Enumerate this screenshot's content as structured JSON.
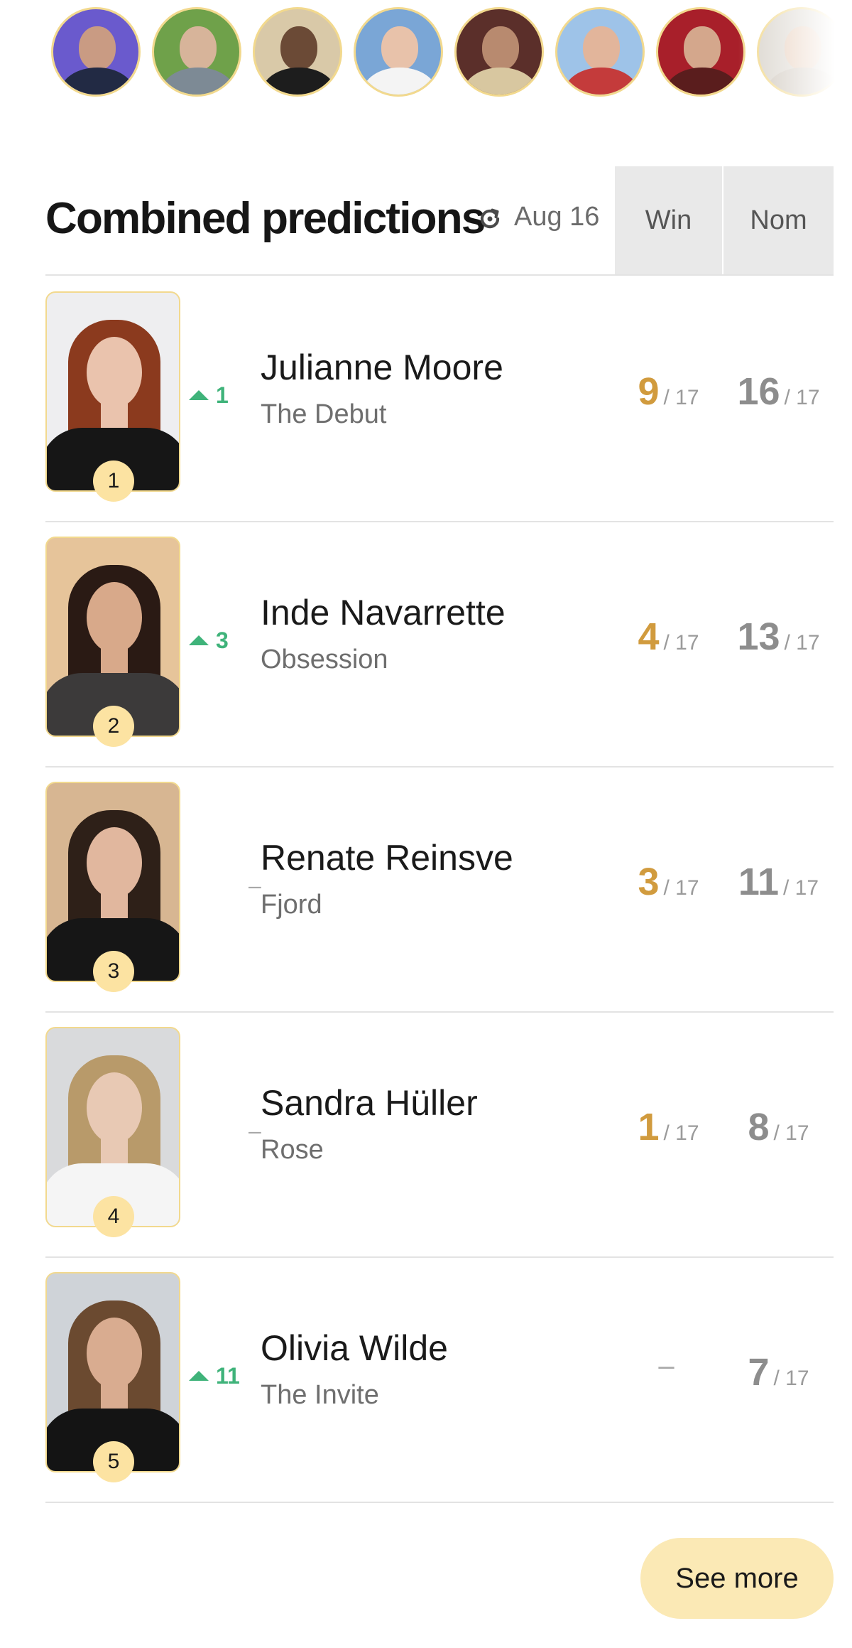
{
  "predictors": [
    {
      "name": "predictor-1",
      "bg": "#6a5acd",
      "skin": "#c99b83",
      "shirt": "#222a44"
    },
    {
      "name": "predictor-2",
      "bg": "#6fa14a",
      "skin": "#d7b49a",
      "shirt": "#7d8a95"
    },
    {
      "name": "predictor-3",
      "bg": "#d9c9a8",
      "skin": "#6b4a36",
      "shirt": "#1d1d1d"
    },
    {
      "name": "predictor-4",
      "bg": "#7aa6d6",
      "skin": "#e8c2aa",
      "shirt": "#f4f4f4"
    },
    {
      "name": "predictor-5",
      "bg": "#5b2f2a",
      "skin": "#b88a6f",
      "shirt": "#d8c7a0"
    },
    {
      "name": "predictor-6",
      "bg": "#9ec3e8",
      "skin": "#e2b59b",
      "shirt": "#c43b3b"
    },
    {
      "name": "predictor-7",
      "bg": "#a81f2a",
      "skin": "#d4a78c",
      "shirt": "#5a1d1d"
    },
    {
      "name": "predictor-8",
      "bg": "#d9d4cc",
      "skin": "#e6cbb7",
      "shirt": "#cfc7bd"
    }
  ],
  "header": {
    "title": "Combined predictions",
    "refresh_icon": "refresh-icon",
    "updated": "Aug 16",
    "col_win": "Win",
    "col_nom": "Nom"
  },
  "rows": [
    {
      "rank": "1",
      "name": "Julianne Moore",
      "film": "The Debut",
      "trend": "up",
      "trend_value": "1",
      "win": "9",
      "win_total": "/ 17",
      "nom": "16",
      "nom_total": "/ 17",
      "photo": {
        "bg": "#eeeef0",
        "hair": "#8b3a1e",
        "skin": "#eac3ad",
        "top": "#161616"
      }
    },
    {
      "rank": "2",
      "name": "Inde Navarrette",
      "film": "Obsession",
      "trend": "up",
      "trend_value": "3",
      "win": "4",
      "win_total": "/ 17",
      "nom": "13",
      "nom_total": "/ 17",
      "photo": {
        "bg": "#e6c49a",
        "hair": "#2a1a14",
        "skin": "#d8a98a",
        "top": "#3c3a3a"
      }
    },
    {
      "rank": "3",
      "name": "Renate Reinsve",
      "film": "Fjord",
      "trend": "flat",
      "trend_value": "–",
      "win": "3",
      "win_total": "/ 17",
      "nom": "11",
      "nom_total": "/ 17",
      "photo": {
        "bg": "#d7b692",
        "hair": "#2e2018",
        "skin": "#e1b79e",
        "top": "#161616"
      }
    },
    {
      "rank": "4",
      "name": "Sandra Hüller",
      "film": "Rose",
      "trend": "flat",
      "trend_value": "–",
      "win": "1",
      "win_total": "/ 17",
      "nom": "8",
      "nom_total": "/ 17",
      "photo": {
        "bg": "#d9dadc",
        "hair": "#b89a6a",
        "skin": "#e8c9b4",
        "top": "#f5f5f5"
      }
    },
    {
      "rank": "5",
      "name": "Olivia Wilde",
      "film": "The Invite",
      "trend": "up",
      "trend_value": "11",
      "win": "–",
      "win_total": "",
      "nom": "7",
      "nom_total": "/ 17",
      "photo": {
        "bg": "#cfd3d8",
        "hair": "#6b4a30",
        "skin": "#d9ac90",
        "top": "#141414"
      }
    }
  ],
  "see_more": "See more"
}
